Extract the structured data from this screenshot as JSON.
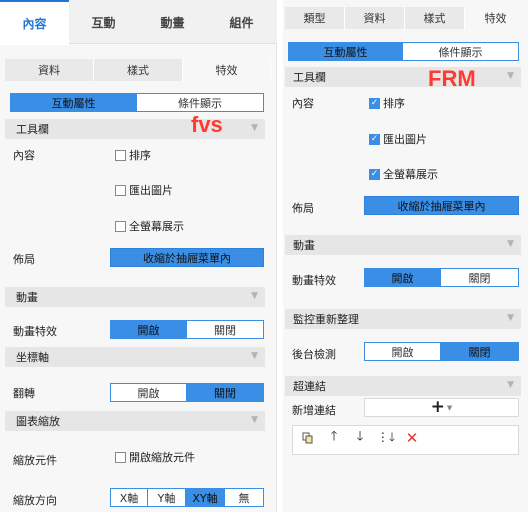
{
  "left": {
    "top_tabs": [
      "內容",
      "互動",
      "動畫",
      "組件"
    ],
    "sub_tabs": [
      "資料",
      "樣式",
      "特效"
    ],
    "mode_buttons": [
      "互動屬性",
      "條件顯示"
    ],
    "watermark": "fvs",
    "sections": {
      "toolbar": "工具欄",
      "animation": "動畫",
      "axis": "坐標軸",
      "zoom": "圖表縮放"
    },
    "content_label": "內容",
    "checkboxes": {
      "sort": "排序",
      "export": "匯出圖片",
      "fullscreen": "全螢幕展示",
      "zoom_enable": "開啟縮放元件"
    },
    "layout_label": "佈局",
    "layout_value": "收縮於抽屜菜單內",
    "anim_effect_label": "動畫特效",
    "flip_label": "翻轉",
    "on": "開啟",
    "off": "關閉",
    "zoom_component_label": "縮放元件",
    "zoom_direction_label": "縮放方向",
    "directions": [
      "X軸",
      "Y軸",
      "XY軸",
      "無"
    ]
  },
  "right": {
    "sub_tabs": [
      "類型",
      "資料",
      "樣式",
      "特效"
    ],
    "mode_buttons": [
      "互動屬性",
      "條件顯示"
    ],
    "watermark": "FRM",
    "sections": {
      "toolbar": "工具欄",
      "animation": "動畫",
      "monitor": "監控重新整理",
      "hyperlink": "超連結"
    },
    "content_label": "內容",
    "checkboxes": {
      "sort": "排序",
      "export": "匯出圖片",
      "fullscreen": "全螢幕展示"
    },
    "layout_label": "佈局",
    "layout_value": "收縮於抽屜菜單內",
    "anim_effect_label": "動畫特效",
    "bg_check_label": "後台檢測",
    "on": "開啟",
    "off": "關閉",
    "add_link_label": "新增連結",
    "add_symbol": "+",
    "colors": {
      "accent": "#3a8ee6",
      "delete": "#e53935"
    }
  }
}
